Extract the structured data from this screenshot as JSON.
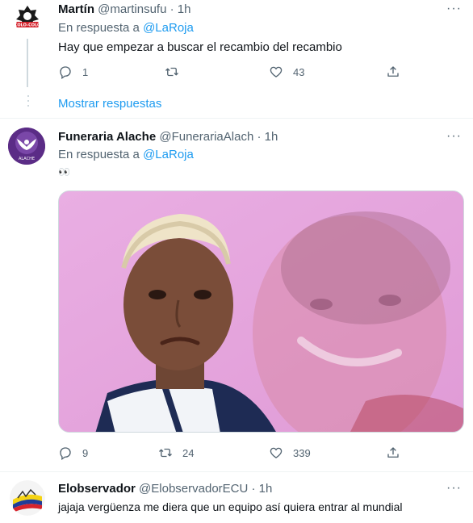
{
  "tweets": [
    {
      "name": "Martín",
      "handle": "@martinsufu",
      "sep": "·",
      "time": "1h",
      "reply_prefix": "En respuesta a",
      "reply_to": "@LaRoja",
      "text": "Hay que empezar a buscar el recambio del recambio",
      "replies": "1",
      "retweets": "",
      "likes": "43",
      "avatar_label": "COLO-COLO"
    },
    {
      "name": "Funeraria Alache",
      "handle": "@FunerariaAlach",
      "sep": "·",
      "time": "1h",
      "reply_prefix": "En respuesta a",
      "reply_to": "@LaRoja",
      "text": "👀",
      "replies": "9",
      "retweets": "24",
      "likes": "339",
      "avatar_label": "ALACHE"
    },
    {
      "name": "Elobservador",
      "handle": "@ElobservadorECU",
      "sep": "·",
      "time": "1h",
      "text": "jajaja vergüenza me diera que un equipo así quiera entrar al mundial"
    }
  ],
  "show_replies": "Mostrar respuestas",
  "more_glyph": "···",
  "colors": {
    "accent": "#1d9bf0",
    "muted": "#536471",
    "media_bg": "#e3a4dc"
  },
  "icons": [
    "reply-icon",
    "retweet-icon",
    "like-icon",
    "share-icon",
    "more-icon"
  ]
}
